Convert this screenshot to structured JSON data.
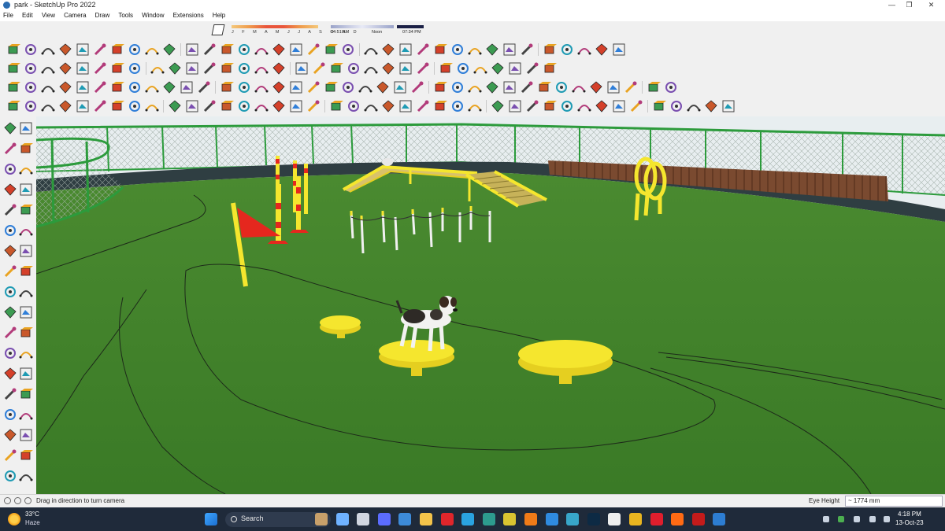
{
  "window": {
    "title": "park - SketchUp Pro 2022",
    "controls": [
      "—",
      "❐",
      "✕"
    ]
  },
  "menu": [
    "File",
    "Edit",
    "View",
    "Camera",
    "Draw",
    "Tools",
    "Window",
    "Extensions",
    "Help"
  ],
  "shadow_widget": {
    "months": "J F M A M J J A S O N D",
    "time_start": "04:51 AM",
    "time_mid": "Noon",
    "time_end": "07:34 PM"
  },
  "toolbars": {
    "row1_icons": [
      "arc-icon",
      "freehand-icon",
      "eraser-icon",
      "follow-me-icon",
      "offset-icon",
      "cloud-icon",
      "hand-icon",
      "curtain-icon",
      "arrow-curve-icon",
      "flag-icon",
      "fillet-icon",
      "chamfer-icon",
      "bend-icon",
      "curve-icon",
      "sweep-icon",
      "loft-icon",
      "grid-icon",
      "wall-icon",
      "stairs-icon",
      "fence-icon",
      "shell-icon",
      "tube-icon",
      "spiral-icon",
      "column-icon",
      "railing-icon",
      "dome-icon",
      "lattice-icon",
      "pattern-icon",
      "cone-icon",
      "cube-icon",
      "roof-icon",
      "house-icon",
      "warehouse-icon",
      "house-outline-icon",
      "garage-icon"
    ],
    "row2_icons": [
      "search-icon",
      "select-icon",
      "eraser-icon",
      "pencil-icon",
      "arc-icon",
      "rectangle-icon",
      "pushpull-icon",
      "follow-icon",
      "move-icon",
      "rotate-icon",
      "scale-icon",
      "tape-icon",
      "text-icon",
      "paint-icon",
      "orbit-icon",
      "pan-icon",
      "zoom-icon",
      "section-icon",
      "layers-icon",
      "scenes-icon",
      "camera-icon",
      "solid-union-icon",
      "solid-subtract-icon",
      "solid-trim-icon",
      "solid-split-icon",
      "solid-intersect-icon",
      "solid-outer-icon",
      "solid-shell-icon",
      "solid-hole-icon",
      "solid-cut-icon",
      "xray-icon"
    ],
    "row3_icons": [
      "section-plane-icon",
      "component-icon",
      "group-icon",
      "hatch-icon",
      "curve-edit-icon",
      "explode-icon",
      "layer-icon",
      "entity-icon",
      "flower-icon",
      "crayon-icon",
      "weld-icon",
      "circle-icon",
      "ellipse-icon",
      "bezier-icon",
      "polyline-icon",
      "smooth-icon",
      "soften-icon",
      "edge-icon",
      "join-icon",
      "curve-path-icon",
      "wave-icon",
      "zigzag-icon",
      "loop-icon",
      "warp-icon",
      "twist-icon",
      "taper-icon",
      "arc-bend-icon",
      "shear-icon",
      "mirror-icon",
      "array-icon",
      "copy-icon",
      "landscape-icon",
      "terrain-icon",
      "sun-icon",
      "render-icon",
      "light-icon",
      "material-icon",
      "skybox-icon"
    ],
    "row4_icons": [
      "cut-icon",
      "paste-icon",
      "stamp-icon",
      "drape-icon",
      "smoove-icon",
      "flip-icon",
      "shapes-icon",
      "photo-icon",
      "matchphoto-icon",
      "sandbox-icon",
      "contour-icon",
      "mesh-icon",
      "cube-blue-icon",
      "diamond-icon",
      "slab-icon",
      "plate-icon",
      "tile-icon",
      "cylinder-icon",
      "stop-icon",
      "flag-red-icon",
      "door-icon",
      "chair-icon",
      "lamp-icon",
      "tree-icon",
      "car-icon",
      "person-icon",
      "bench-icon",
      "light-post-icon",
      "table-icon",
      "cone-red-icon",
      "pyramid-icon",
      "dog-icon",
      "paw-icon",
      "bone-icon",
      "hurdle-icon",
      "tunnel-icon",
      "ramp-icon",
      "seesaw-icon",
      "pole-icon",
      "hoop-icon",
      "pad-icon"
    ]
  },
  "viewport": {
    "scene": "dog agility park"
  },
  "status": {
    "message": "Drag in direction to turn camera",
    "eye_height_label": "Eye Height",
    "eye_height_value": "~ 1774 mm"
  },
  "taskbar": {
    "temperature": "33°C",
    "condition": "Haze",
    "search_placeholder": "Search",
    "time": "4:18 PM",
    "date": "13-Oct-23"
  },
  "colors": {
    "grass": "#3f7d2a",
    "yellow": "#f5e62e",
    "red": "#e5271e",
    "fence": "#2c9b3c",
    "track": "#2f3e42",
    "taskbar": "#1f2a3a"
  }
}
